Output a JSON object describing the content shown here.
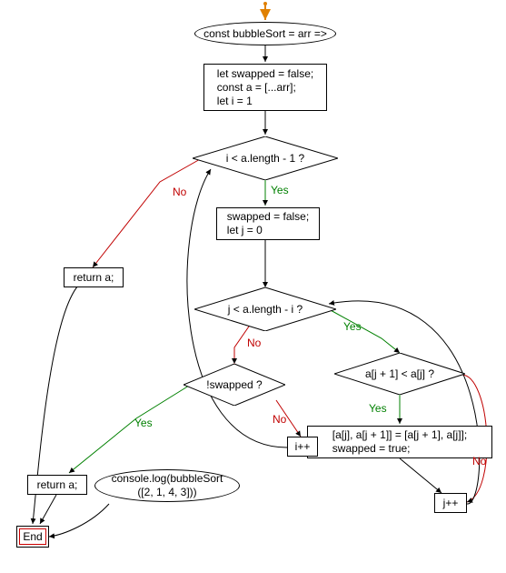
{
  "nodes": {
    "start": {
      "label": "const bubbleSort = arr =>"
    },
    "init": {
      "label": "let swapped = false;\nconst a = [...arr];\nlet i = 1"
    },
    "outerCond": {
      "label": "i < a.length - 1 ?"
    },
    "outerBody": {
      "label": "swapped = false;\nlet j = 0"
    },
    "innerCond": {
      "label": "j < a.length - i ?"
    },
    "compare": {
      "label": "a[j + 1] < a[j] ?"
    },
    "swap": {
      "label": "[a[j], a[j + 1]] = [a[j + 1], a[j]];\nswapped = true;"
    },
    "jInc": {
      "label": "j++"
    },
    "swappedCond": {
      "label": "!swapped ?"
    },
    "iInc": {
      "label": "i++"
    },
    "return1": {
      "label": "return a;"
    },
    "return2": {
      "label": "return a;"
    },
    "log": {
      "label": "console.log(bubbleSort\n([2, 1, 4, 3]))"
    },
    "end": {
      "label": "End"
    }
  },
  "edges": {
    "outerCond_yes": "Yes",
    "outerCond_no": "No",
    "innerCond_yes": "Yes",
    "innerCond_no": "No",
    "compare_yes": "Yes",
    "compare_no": "No",
    "swapped_yes": "Yes",
    "swapped_no": "No"
  },
  "chart_data": {
    "type": "flowchart",
    "title": "bubbleSort",
    "nodes": [
      {
        "id": "entry",
        "kind": "entry-arrow"
      },
      {
        "id": "start",
        "kind": "terminator",
        "text": "const bubbleSort = arr =>"
      },
      {
        "id": "init",
        "kind": "process",
        "text": "let swapped = false; const a = [...arr]; let i = 1"
      },
      {
        "id": "outerCond",
        "kind": "decision",
        "text": "i < a.length - 1 ?"
      },
      {
        "id": "outerBody",
        "kind": "process",
        "text": "swapped = false; let j = 0"
      },
      {
        "id": "innerCond",
        "kind": "decision",
        "text": "j < a.length - i ?"
      },
      {
        "id": "compare",
        "kind": "decision",
        "text": "a[j + 1] < a[j] ?"
      },
      {
        "id": "swap",
        "kind": "process",
        "text": "[a[j], a[j + 1]] = [a[j + 1], a[j]]; swapped = true;"
      },
      {
        "id": "jInc",
        "kind": "process",
        "text": "j++"
      },
      {
        "id": "swappedCond",
        "kind": "decision",
        "text": "!swapped ?"
      },
      {
        "id": "iInc",
        "kind": "process",
        "text": "i++"
      },
      {
        "id": "return1",
        "kind": "process",
        "text": "return a;"
      },
      {
        "id": "return2",
        "kind": "process",
        "text": "return a;"
      },
      {
        "id": "log",
        "kind": "terminator",
        "text": "console.log(bubbleSort([2, 1, 4, 3]))"
      },
      {
        "id": "end",
        "kind": "terminator",
        "text": "End"
      }
    ],
    "edges": [
      {
        "from": "entry",
        "to": "start"
      },
      {
        "from": "start",
        "to": "init"
      },
      {
        "from": "init",
        "to": "outerCond"
      },
      {
        "from": "outerCond",
        "to": "outerBody",
        "label": "Yes"
      },
      {
        "from": "outerCond",
        "to": "return1",
        "label": "No"
      },
      {
        "from": "outerBody",
        "to": "innerCond"
      },
      {
        "from": "innerCond",
        "to": "compare",
        "label": "Yes"
      },
      {
        "from": "innerCond",
        "to": "swappedCond",
        "label": "No"
      },
      {
        "from": "compare",
        "to": "swap",
        "label": "Yes"
      },
      {
        "from": "compare",
        "to": "jInc",
        "label": "No"
      },
      {
        "from": "swap",
        "to": "jInc"
      },
      {
        "from": "jInc",
        "to": "innerCond"
      },
      {
        "from": "swappedCond",
        "to": "return2",
        "label": "Yes"
      },
      {
        "from": "swappedCond",
        "to": "iInc",
        "label": "No"
      },
      {
        "from": "iInc",
        "to": "outerCond"
      },
      {
        "from": "return1",
        "to": "end"
      },
      {
        "from": "return2",
        "to": "end"
      },
      {
        "from": "log",
        "to": "end"
      }
    ]
  }
}
